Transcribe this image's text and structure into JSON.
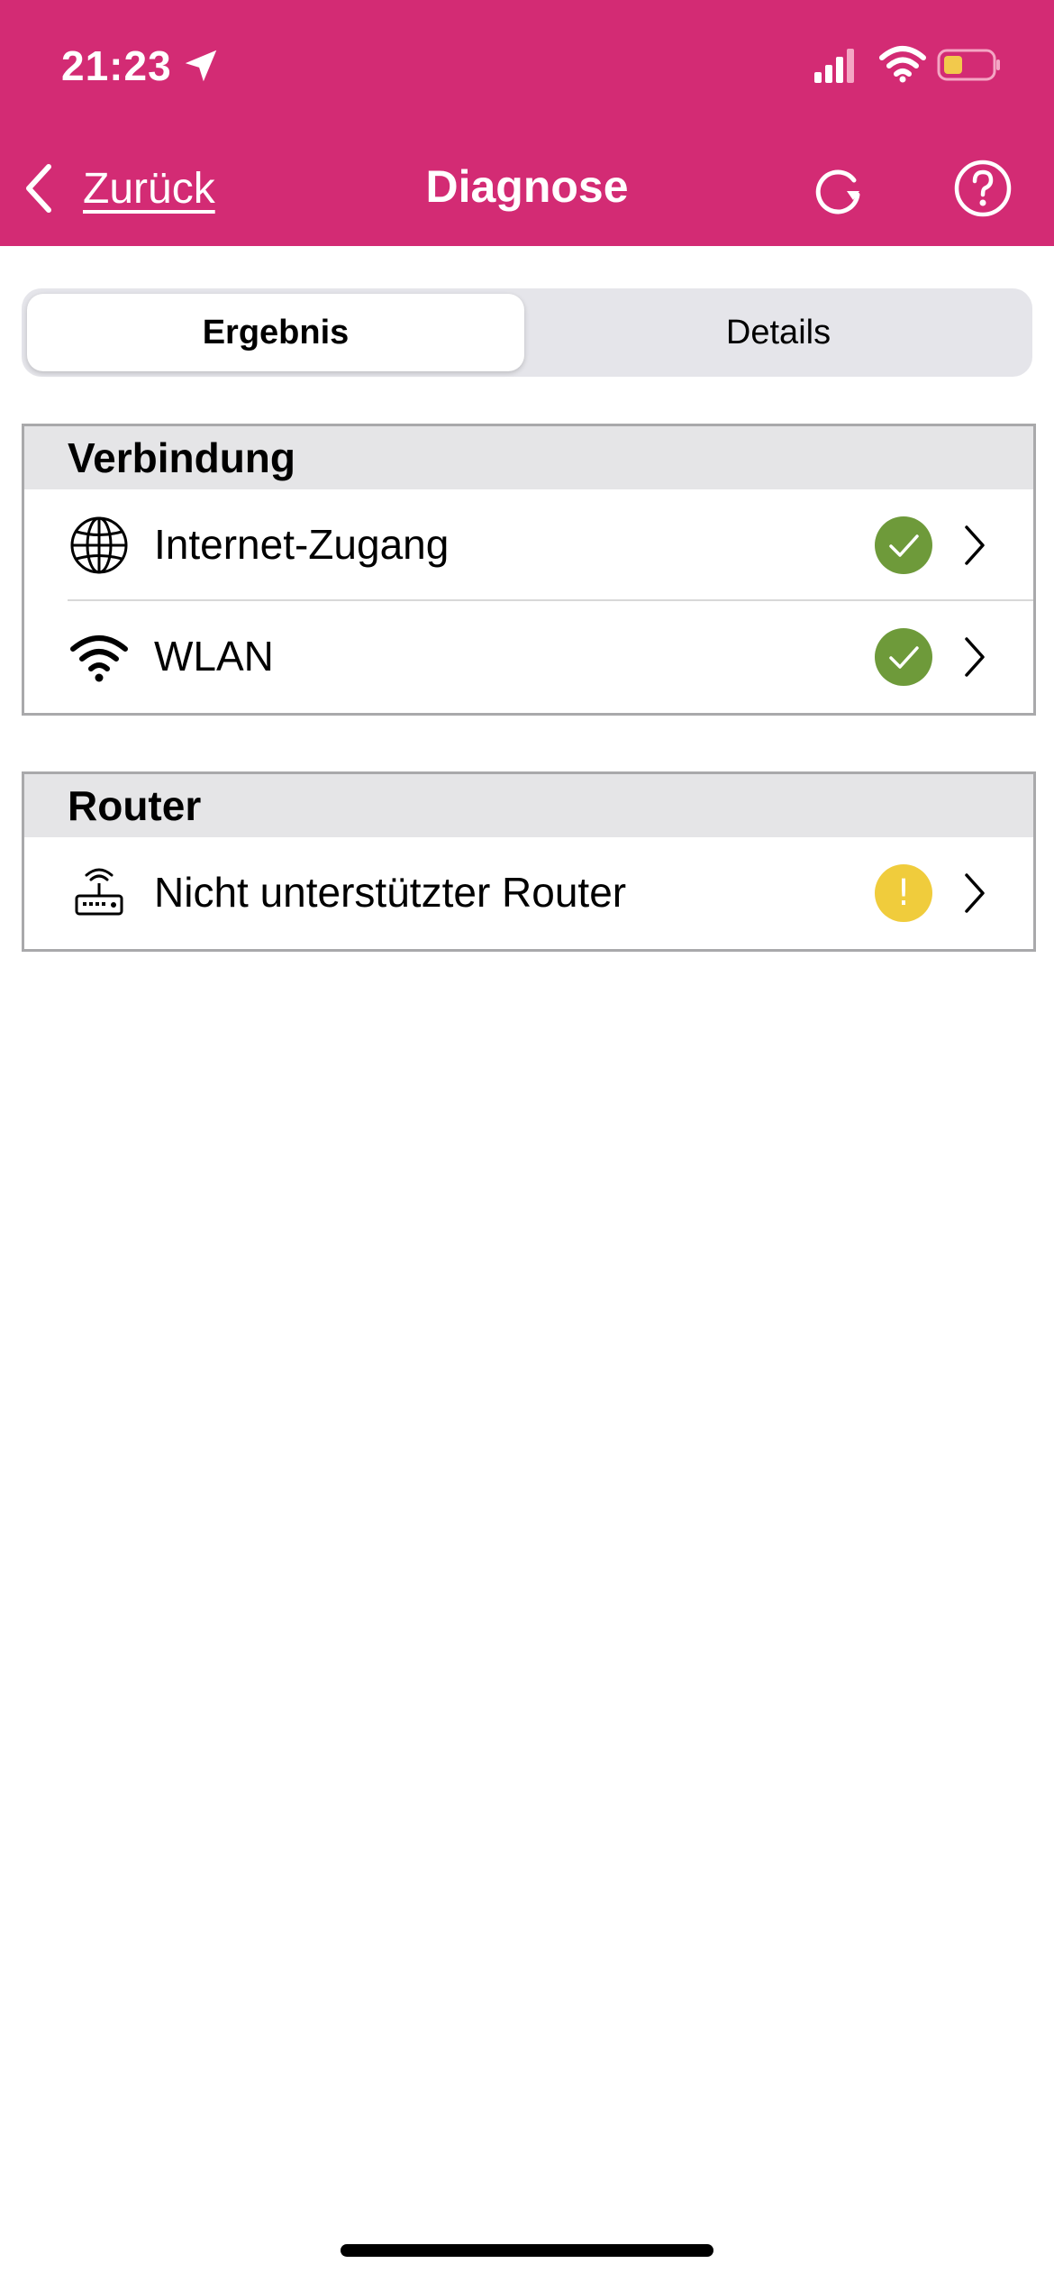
{
  "status_bar": {
    "time": "21:23",
    "icons": [
      "location-arrow-icon",
      "cellular-signal-icon",
      "wifi-icon",
      "battery-icon"
    ],
    "battery_color": "#f2c94c"
  },
  "nav": {
    "back_label": "Zurück",
    "title": "Diagnose",
    "icons": [
      "chevron-left-icon",
      "refresh-icon",
      "help-icon"
    ]
  },
  "tabs": [
    {
      "label": "Ergebnis",
      "selected": true
    },
    {
      "label": "Details",
      "selected": false
    }
  ],
  "sections": [
    {
      "title": "Verbindung",
      "rows": [
        {
          "label": "Internet-Zugang",
          "icon": "globe-icon",
          "status": "ok"
        },
        {
          "label": "WLAN",
          "icon": "wifi-icon",
          "status": "ok"
        }
      ]
    },
    {
      "title": "Router",
      "rows": [
        {
          "label": "Nicht unterstützter Router",
          "icon": "router-icon",
          "status": "warning",
          "status_symbol": "!"
        }
      ]
    }
  ],
  "colors": {
    "brand": "#d32b74",
    "ok": "#6e9a3a",
    "warning": "#f0cc3c",
    "section_header_bg": "#e5e5e7"
  }
}
